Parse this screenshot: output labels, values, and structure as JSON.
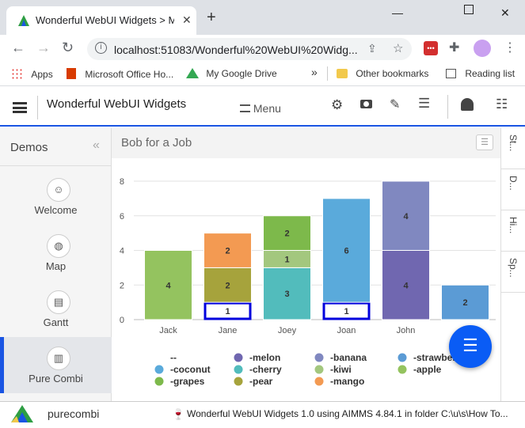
{
  "browser": {
    "tab_title": "Wonderful WebUI Widgets > Ma",
    "url": "localhost:51083/Wonderful%20WebUI%20Widg...",
    "bookmarks": [
      "Apps",
      "Microsoft Office Ho...",
      "My Google Drive"
    ],
    "other_bookmarks": "Other bookmarks",
    "reading_list": "Reading list",
    "overflow": "»"
  },
  "header": {
    "title": "Wonderful WebUI Widgets",
    "menu_label": "Menu"
  },
  "sidebar": {
    "title": "Demos",
    "collapse_glyph": "«",
    "items": [
      {
        "label": "Welcome",
        "icon": "smiley-icon",
        "glyph": "☺"
      },
      {
        "label": "Map",
        "icon": "globe-icon",
        "glyph": "◍"
      },
      {
        "label": "Gantt",
        "icon": "gantt-icon",
        "glyph": "▤"
      },
      {
        "label": "Pure Combi",
        "icon": "chart-icon",
        "glyph": "▥"
      }
    ]
  },
  "main": {
    "title": "Bob for a Job"
  },
  "right_tabs": [
    "St...",
    "D...",
    "Hi...",
    "Sp..."
  ],
  "statusbar": {
    "app_name": "purecombi",
    "status": "Wonderful WebUI Widgets 1.0 using AIMMS 4.84.1 in folder C:\\u\\s\\How To..."
  },
  "colors": {
    "accent": "#1a55e3",
    "fab": "#0a5cf5"
  },
  "chart_data": {
    "type": "bar",
    "stacked": true,
    "categories": [
      "Jack",
      "Jane",
      "Joey",
      "Joan",
      "John"
    ],
    "ylim": [
      0,
      8
    ],
    "yticks": [
      0,
      2,
      4,
      6,
      8
    ],
    "grid": true,
    "legend_position": "bottom",
    "stacks": [
      {
        "category": "Jack",
        "segments": [
          {
            "series": "-apple",
            "value": 4
          }
        ]
      },
      {
        "category": "Jane",
        "segments": [
          {
            "series": "--",
            "value": 1
          },
          {
            "series": "-pear",
            "value": 2
          },
          {
            "series": "-mango",
            "value": 2
          }
        ]
      },
      {
        "category": "Joey",
        "segments": [
          {
            "series": "-cherry",
            "value": 3
          },
          {
            "series": "-kiwi",
            "value": 1
          },
          {
            "series": "-grapes",
            "value": 2
          }
        ]
      },
      {
        "category": "Joan",
        "segments": [
          {
            "series": "--",
            "value": 1
          },
          {
            "series": "-coconut",
            "value": 6
          }
        ]
      },
      {
        "category": "John",
        "segments": [
          {
            "series": "-melon",
            "value": 4
          },
          {
            "series": "-banana",
            "value": 4
          }
        ]
      },
      {
        "category": "",
        "segments": [
          {
            "series": "-strawberry",
            "value": 2
          }
        ]
      }
    ],
    "series": [
      {
        "name": "--",
        "color": "#ffffff",
        "stroke": "#0000dd"
      },
      {
        "name": "-melon",
        "color": "#7067b0"
      },
      {
        "name": "-banana",
        "color": "#8088c0"
      },
      {
        "name": "-strawberry",
        "color": "#5b9bd5"
      },
      {
        "name": "-coconut",
        "color": "#5aaadb"
      },
      {
        "name": "-cherry",
        "color": "#52bcbc"
      },
      {
        "name": "-kiwi",
        "color": "#a3c77e"
      },
      {
        "name": "-apple",
        "color": "#94c35f"
      },
      {
        "name": "-grapes",
        "color": "#7db94b"
      },
      {
        "name": "-pear",
        "color": "#a6a33c"
      },
      {
        "name": "-mango",
        "color": "#f39a52"
      }
    ],
    "legend_order": [
      "--",
      "-melon",
      "-banana",
      "-strawberry",
      "-coconut",
      "-cherry",
      "-kiwi",
      "-apple",
      "-grapes",
      "-pear",
      "-mango"
    ]
  }
}
